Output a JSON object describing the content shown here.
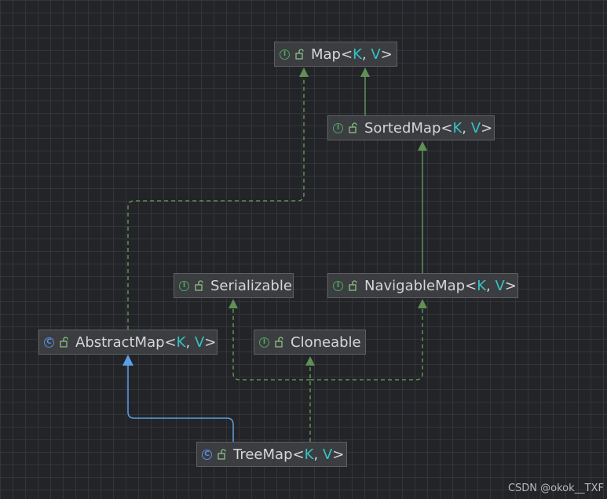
{
  "nodes": {
    "map": {
      "kind": "interface",
      "name": "Map",
      "lt": "<",
      "p1": "K",
      "sep": ", ",
      "p2": "V",
      "gt": ">"
    },
    "sorted_map": {
      "kind": "interface",
      "name": "SortedMap",
      "lt": "<",
      "p1": "K",
      "sep": ", ",
      "p2": "V",
      "gt": ">"
    },
    "serializable": {
      "kind": "interface",
      "name": "Serializable"
    },
    "navigable_map": {
      "kind": "interface",
      "name": "NavigableMap",
      "lt": "<",
      "p1": "K",
      "sep": ", ",
      "p2": "V",
      "gt": ">"
    },
    "abstract_map": {
      "kind": "class",
      "name": "AbstractMap",
      "lt": "<",
      "p1": "K",
      "sep": ", ",
      "p2": "V",
      "gt": ">"
    },
    "cloneable": {
      "kind": "interface",
      "name": "Cloneable"
    },
    "tree_map": {
      "kind": "class",
      "name": "TreeMap",
      "lt": "<",
      "p1": "K",
      "sep": ", ",
      "p2": "V",
      "gt": ">"
    }
  },
  "badges": {
    "interface": "I",
    "class": "C"
  },
  "colors": {
    "background": "#232427",
    "grid": "#33353a",
    "extends_interface": "#5f9157",
    "implements": "#5f9157",
    "extends_class": "#5c9fe8",
    "type_param": "#36c3c5"
  },
  "edges": [
    {
      "from": "sorted_map",
      "to": "map",
      "style": "solid",
      "color": "green"
    },
    {
      "from": "abstract_map",
      "to": "map",
      "style": "dashed",
      "color": "green"
    },
    {
      "from": "navigable_map",
      "to": "sorted_map",
      "style": "solid",
      "color": "green"
    },
    {
      "from": "tree_map",
      "to": "abstract_map",
      "style": "solid",
      "color": "blue"
    },
    {
      "from": "tree_map",
      "to": "serializable",
      "style": "dashed",
      "color": "green"
    },
    {
      "from": "tree_map",
      "to": "cloneable",
      "style": "dashed",
      "color": "green"
    },
    {
      "from": "tree_map",
      "to": "navigable_map",
      "style": "dashed",
      "color": "green"
    }
  ],
  "watermark": "CSDN @okok__TXF"
}
